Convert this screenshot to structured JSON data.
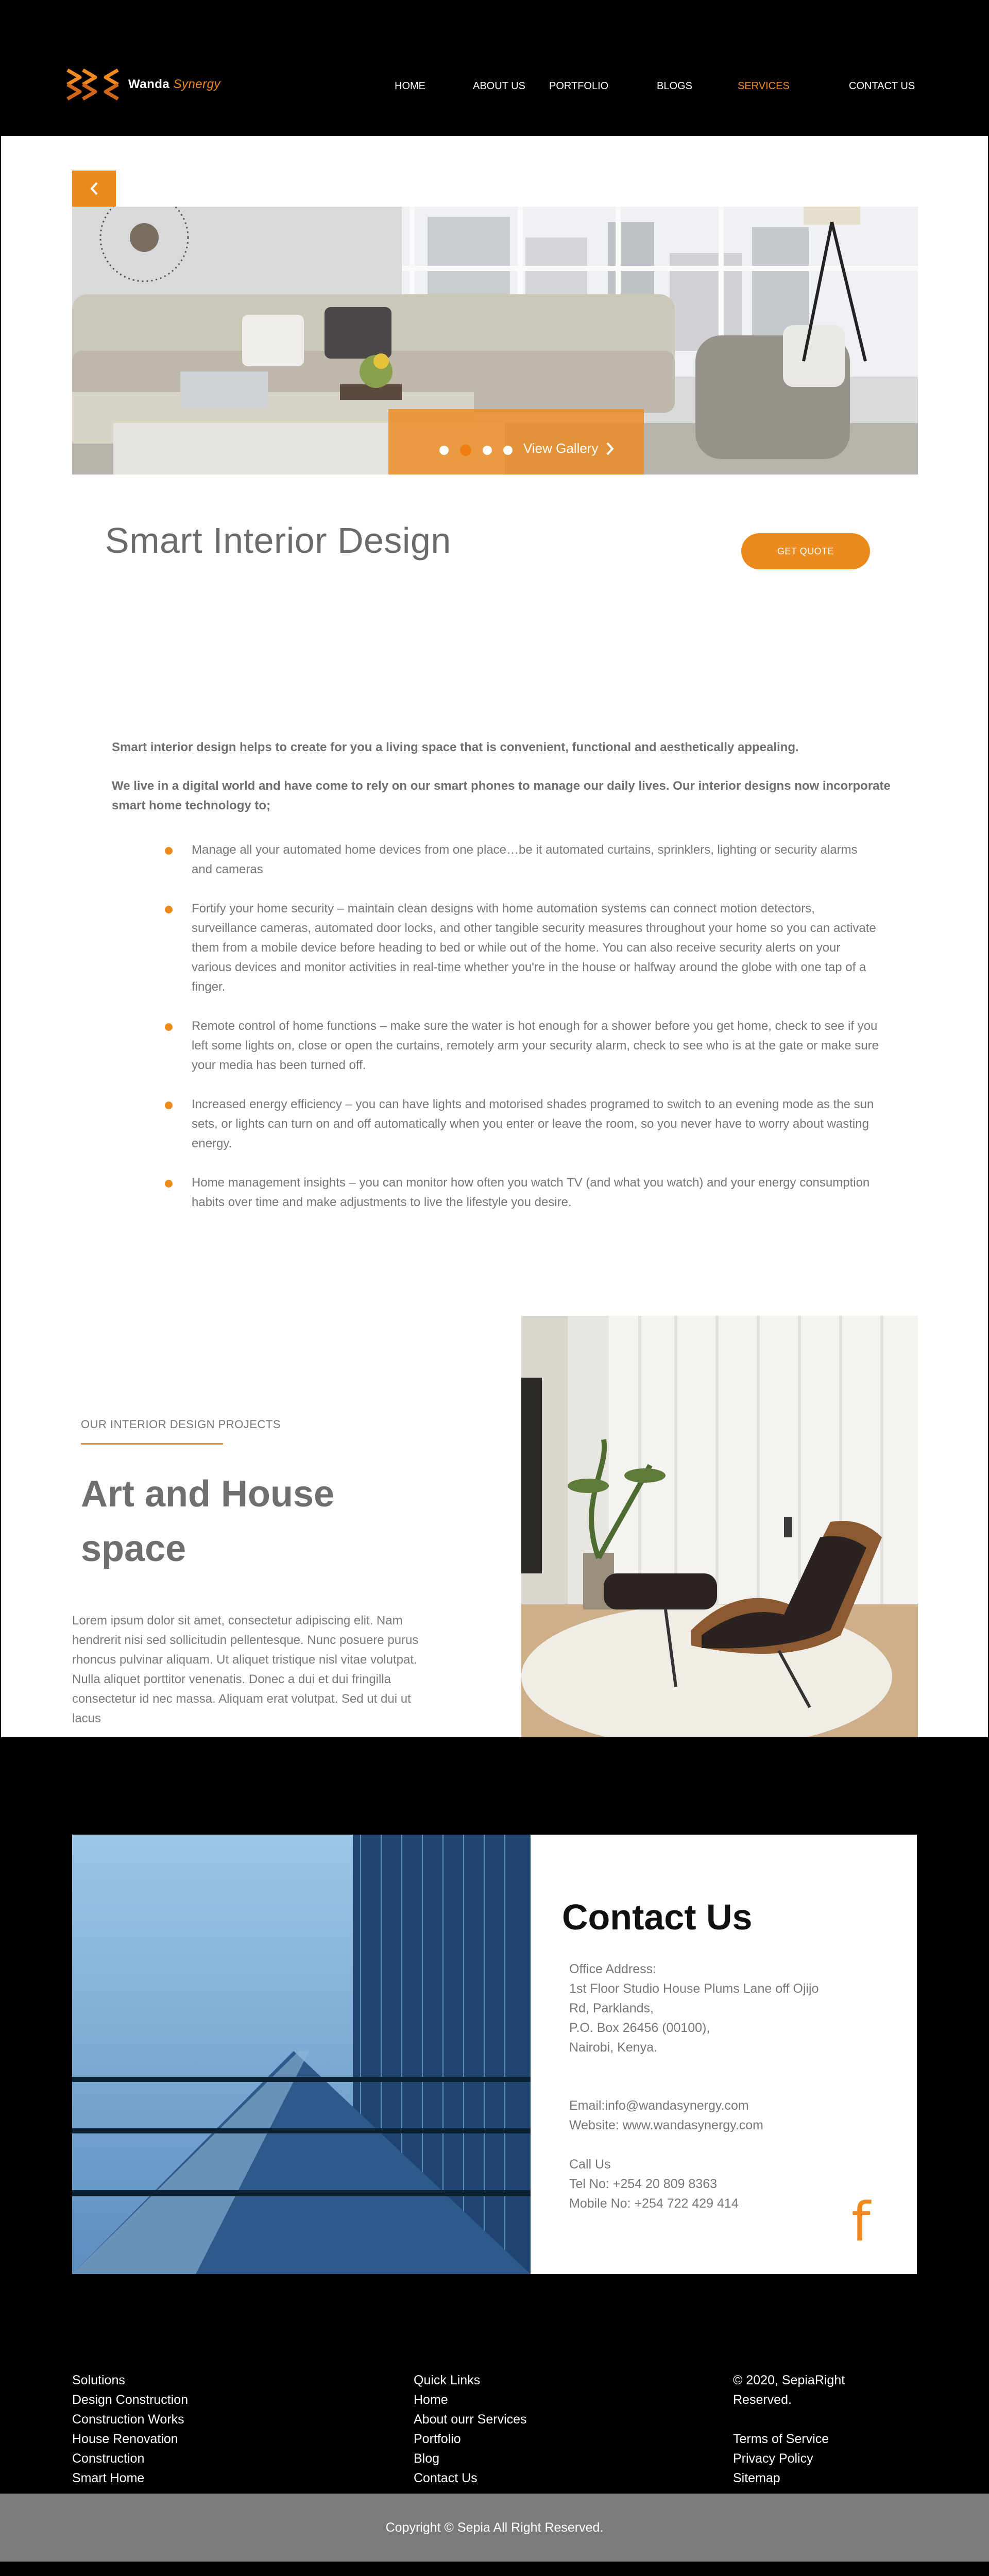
{
  "header": {
    "brand_name": "Wanda",
    "brand_accent": "Synergy",
    "nav": [
      {
        "label": "HOME"
      },
      {
        "label": "ABOUT US"
      },
      {
        "label": "PORTFOLIO"
      },
      {
        "label": "BLOGS"
      },
      {
        "label": "SERVICES",
        "active": true
      },
      {
        "label": "CONTACT US"
      }
    ]
  },
  "hero": {
    "back_icon": "chevron-left-icon",
    "gallery_label": "View Gallery",
    "gallery_icon": "chevron-right-icon",
    "slide_count": 4,
    "active_slide": 2
  },
  "service": {
    "title": "Smart Interior Design",
    "quote_button": "GET QUOTE",
    "intro_1": "Smart interior design helps to create for you a living space that is convenient, functional and aesthetically appealing.",
    "intro_2": "We live in a digital world and have come to rely on our smart phones to manage our daily lives. Our interior designs now incorporate smart home technology to;",
    "points": [
      "Manage all your automated home devices from one place…be it automated curtains, sprinklers, lighting or security alarms and cameras",
      "Fortify your home security – maintain clean designs with home automation systems can connect motion detectors, surveillance cameras, automated door locks, and other tangible security measures throughout your home so you can activate them from a mobile device before heading to bed or while out of the home. You can also receive security alerts on your various devices and monitor activities in real-time whether you're in the house or halfway around the globe with one tap of a finger.",
      "Remote control of home functions – make sure the water is hot enough for a shower before you get home, check to see if you left some lights on, close or open the curtains, remotely arm your security alarm, check to see who is at the gate or make sure your media has been turned off.",
      "Increased energy efficiency – you can have lights and motorised shades programed to switch to an evening mode as the sun sets, or lights can turn on and off automatically when you enter or leave the room, so you never have to worry about wasting energy.",
      "Home management insights – you can monitor how often you watch TV (and what you watch) and your energy consumption habits over time and make adjustments to live the lifestyle you desire."
    ]
  },
  "projects": {
    "eyebrow": "OUR INTERIOR DESIGN PROJECTS",
    "title": "Art and House space",
    "text": "Lorem ipsum dolor sit amet, consectetur adipiscing elit. Nam hendrerit nisi sed sollicitudin pellentesque. Nunc posuere purus rhoncus pulvinar aliquam. Ut aliquet tristique nisl vitae volutpat. Nulla aliquet porttitor venenatis. Donec a dui et dui fringilla consectetur id nec massa. Aliquam erat volutpat. Sed ut dui ut lacus"
  },
  "contact": {
    "title": "Contact Us",
    "office_label": "Office Address:",
    "office_lines": [
      "1st Floor Studio House Plums Lane off Ojijo",
      "Rd, Parklands,",
      "P.O. Box 26456 (00100),",
      "Nairobi, Kenya."
    ],
    "email": "Email:info@wandasynergy.com",
    "website": "Website: www.wandasynergy.com",
    "call_label": "Call Us",
    "tel": "Tel No: +254 20 809 8363",
    "mobile": "Mobile No: +254 722 429 414",
    "social_icon": "facebook-icon",
    "social_glyph": "f"
  },
  "footer": {
    "col1": [
      "Solutions",
      "Design Construction",
      "Construction Works",
      "House Renovation",
      "Construction",
      "Smart Home"
    ],
    "col2": [
      "Quick Links",
      "Home",
      "About ourr Services",
      "Portfolio",
      "Blog",
      "Contact Us"
    ],
    "col3": [
      "© 2020, SepiaRight",
      "Reserved.",
      "",
      "Terms of Service",
      "Privacy Policy",
      "Sitemap"
    ],
    "copyright": "Copyright © Sepia All Right Reserved."
  },
  "colors": {
    "accent": "#ec8a1e",
    "dark": "#000000",
    "text": "#6b6b6b",
    "copybar": "#7b7b7b"
  }
}
